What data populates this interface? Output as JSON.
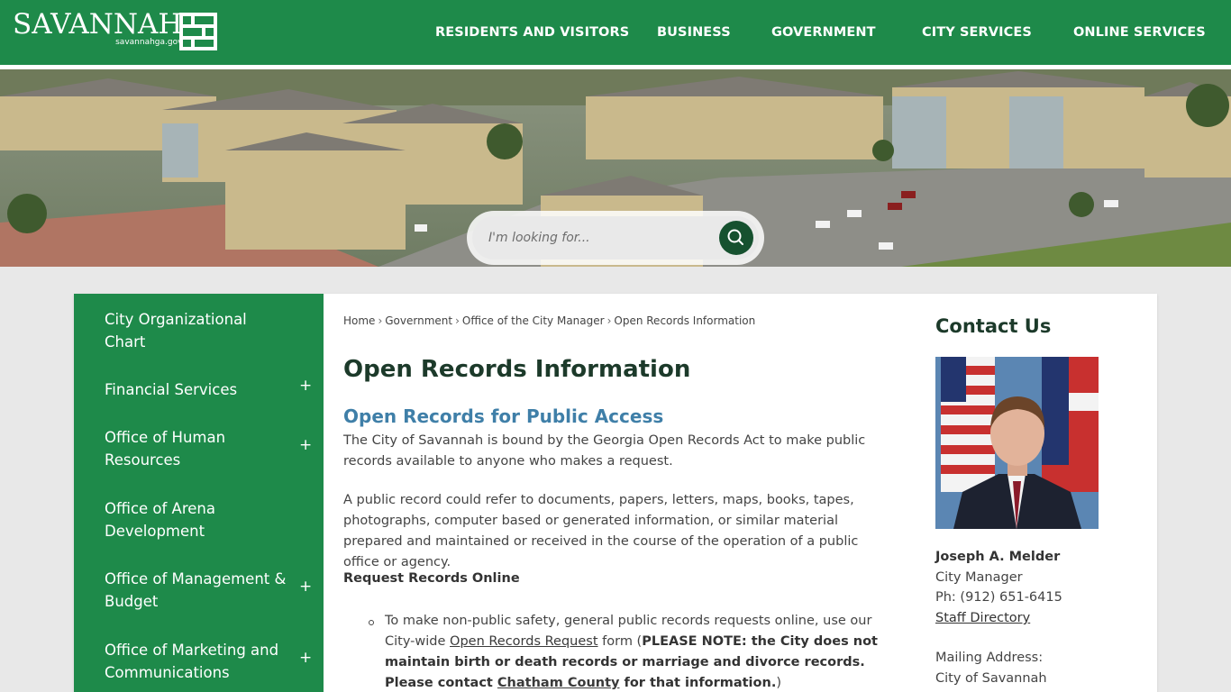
{
  "header": {
    "logo_word": "Savannah",
    "logo_url": "savannahga.gov",
    "nav": [
      {
        "label": "RESIDENTS AND VISITORS"
      },
      {
        "label": "BUSINESS"
      },
      {
        "label": "GOVERNMENT"
      },
      {
        "label": "CITY SERVICES"
      },
      {
        "label": "ONLINE SERVICES"
      }
    ]
  },
  "search": {
    "placeholder": "I'm looking for...",
    "icon": "search-icon"
  },
  "sidebar": {
    "items": [
      {
        "label": "City Organizational Chart",
        "expandable": false
      },
      {
        "label": "Financial Services",
        "expandable": true
      },
      {
        "label": "Office of Human Resources",
        "expandable": true
      },
      {
        "label": "Office of Arena Development",
        "expandable": false
      },
      {
        "label": "Office of Management & Budget",
        "expandable": true
      },
      {
        "label": "Office of Marketing and Communications",
        "expandable": true
      }
    ],
    "expand_symbol": "+"
  },
  "breadcrumb": {
    "items": [
      "Home",
      "Government",
      "Office of the City Manager",
      "Open Records Information"
    ],
    "separator": "›"
  },
  "main": {
    "title": "Open Records Information",
    "subtitle": "Open Records for Public Access",
    "para1": "The City of Savannah is bound by the Georgia Open Records Act to make public records available to anyone who makes a request.",
    "para2": "A public record could refer to documents, papers, letters, maps, books, tapes, photographs, computer based or generated information, or similar material prepared and maintained or received in the course of the operation of a public office or agency.",
    "request_heading": "Request Records Online",
    "list_item": {
      "text_before": "To make non-public safety, general public records requests online, use our City-wide ",
      "link": "Open Records Request",
      "text_after": " form (",
      "note_bold": "PLEASE NOTE: the City does not maintain birth or death records or marriage and divorce records. Please contact ",
      "county_link": "Chatham County",
      "note_end": " for that information.",
      "close": ")"
    }
  },
  "contact": {
    "title": "Contact Us",
    "name": "Joseph A. Melder",
    "role": "City Manager",
    "phone": "Ph: (912) 651-6415",
    "staff_link": "Staff Directory",
    "mailing_label": "Mailing Address:",
    "mailing_line1": "City of Savannah"
  },
  "colors": {
    "brand_green": "#1e8a4a",
    "dark_green": "#16512f",
    "subtitle_blue": "#3f7fa8"
  }
}
